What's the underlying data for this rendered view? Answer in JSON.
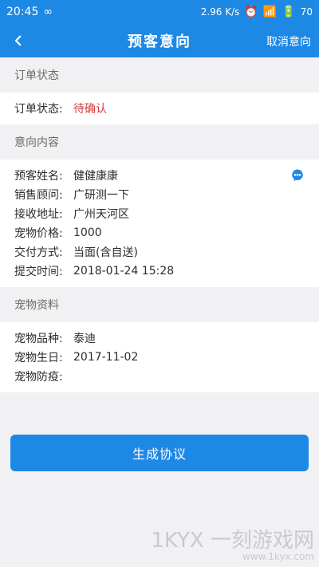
{
  "status_bar": {
    "time": "20:45",
    "loop_symbol": "∞",
    "speed": "2.96 K/s",
    "battery": "70"
  },
  "app_bar": {
    "back_label": "‹",
    "title": "预客意向",
    "cancel": "取消意向"
  },
  "sections": {
    "order": {
      "header": "订单状态",
      "rows": [
        {
          "label": "订单状态:",
          "value": "待确认"
        }
      ]
    },
    "intent": {
      "header": "意向内容",
      "rows": [
        {
          "label": "预客姓名:",
          "value": "健健康康"
        },
        {
          "label": "销售顾问:",
          "value": "广研测一下"
        },
        {
          "label": "接收地址:",
          "value": "广州天河区"
        },
        {
          "label": "宠物价格:",
          "value": "1000"
        },
        {
          "label": "交付方式:",
          "value": "当面(含自送)"
        },
        {
          "label": "提交时间:",
          "value": "2018-01-24 15:28"
        }
      ]
    },
    "pet": {
      "header": "宠物资料",
      "rows": [
        {
          "label": "宠物品种:",
          "value": "泰迪"
        },
        {
          "label": "宠物生日:",
          "value": "2017-11-02"
        },
        {
          "label": "宠物防疫:",
          "value": ""
        }
      ]
    }
  },
  "actions": {
    "generate_agreement": "生成协议"
  },
  "watermark": {
    "main": "1KYX 一刻游戏网",
    "sub": "www.1kyx.com"
  },
  "colors": {
    "primary": "#1e88e5",
    "status_red": "#d43b3b"
  },
  "icons": {
    "back": "chevron-left-icon",
    "chat": "chat-bubble-icon"
  }
}
